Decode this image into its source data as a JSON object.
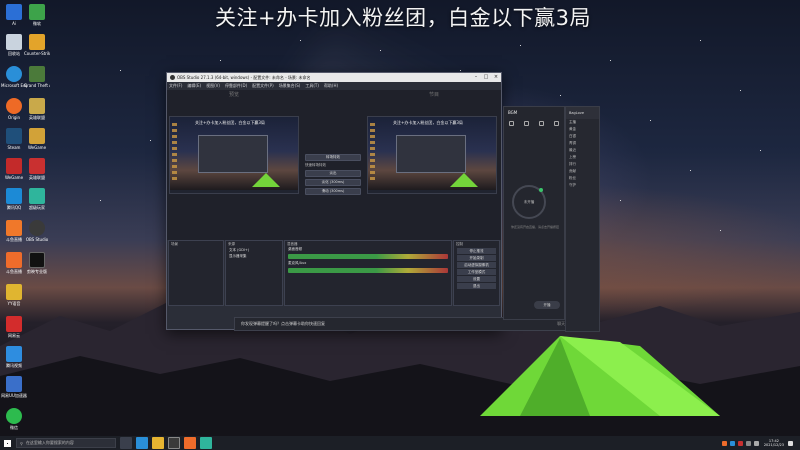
{
  "banner": {
    "text": "关注+办卡加入粉丝团，白金以下赢3局"
  },
  "desktop": {
    "icons": [
      {
        "label": "Ai",
        "icon": "app-icon-a",
        "color": "#2b6fd6"
      },
      {
        "label": "微软",
        "icon": "app-icon-green",
        "color": "#3da34a"
      },
      {
        "label": "回收站",
        "icon": "recycle-bin-icon",
        "color": "#c9d3de"
      },
      {
        "label": "Counter-Strike: Global Off...",
        "icon": "csgo-icon",
        "color": "#e3a42a"
      },
      {
        "label": "Microsoft Edge",
        "icon": "edge-icon",
        "color": "#2a8fd8"
      },
      {
        "label": "Grand Theft Auto V",
        "icon": "gta-icon",
        "color": "#4b7a3a"
      },
      {
        "label": "Origin",
        "icon": "origin-icon",
        "color": "#ee6a26"
      },
      {
        "label": "英雄联盟",
        "icon": "lol-icon",
        "color": "#c9a94a"
      },
      {
        "label": "Steam",
        "icon": "steam-icon",
        "color": "#1f4f7a"
      },
      {
        "label": "WeGame",
        "icon": "wegame-icon",
        "color": "#d2a238"
      },
      {
        "label": "WeGame",
        "icon": "wegame-icon-2",
        "color": "#c32a2a"
      },
      {
        "label": "英雄联盟",
        "icon": "lol-icon-2",
        "color": "#c93030"
      },
      {
        "label": "腾讯QQ",
        "icon": "qq-icon",
        "color": "#1c8ad6"
      },
      {
        "label": "超级玩家",
        "icon": "player-icon",
        "color": "#2fb59c"
      },
      {
        "label": "斗鱼直播",
        "icon": "douyu-icon",
        "color": "#f0782a"
      },
      {
        "label": "OBS Studio",
        "icon": "obs-icon",
        "color": "#3a3a3a"
      },
      {
        "label": "斗鱼直播",
        "icon": "douyu-icon-2",
        "color": "#ef6c2b"
      },
      {
        "label": "剪映专业版",
        "icon": "jianying-icon",
        "color": "#111111"
      },
      {
        "label": "YY语音",
        "icon": "yy-icon",
        "color": "#e0b530"
      },
      {
        "label": "网易云",
        "icon": "netease-icon",
        "color": "#d32c2c"
      },
      {
        "label": "腾讯视频",
        "icon": "video-icon",
        "color": "#2e8de0"
      },
      {
        "label": "网易UU加速器",
        "icon": "uu-icon",
        "color": "#3a6fc9"
      },
      {
        "label": "微信",
        "icon": "wechat-icon",
        "color": "#2dbb4e"
      }
    ]
  },
  "obs": {
    "title": "OBS Studio 27.1.3 (64-bit, windows) - 配置文件: 未命名 - 场景: 未命名",
    "menu": [
      "文件(F)",
      "编辑(E)",
      "视图(V)",
      "停靠部件(D)",
      "配置文件(P)",
      "场景集合(S)",
      "工具(T)",
      "帮助(H)"
    ],
    "preview_label": "预览",
    "program_label": "节目",
    "preview_caption": "关注+办卡加入粉丝团，白金以下赢3局",
    "transition_btn": "转场特效",
    "transition_label": "快速转场特效",
    "transition_items": [
      "淡出",
      "淡化 (300ms)",
      "滑动 (300ms)"
    ],
    "scenes_header": "场景",
    "sources_header": "来源",
    "scene_items": [
      "文本 (GDI+)",
      "显示器采集"
    ],
    "mixer_header": "混音器",
    "mixer_tracks": [
      "桌面音频",
      "麦克风/Aux"
    ],
    "controls_header": "控制",
    "controls": [
      "停止推流",
      "开始录制",
      "启动虚拟摄像机",
      "工作室模式",
      "设置",
      "退出"
    ],
    "status": "LIVE: 00:00:00  REC: 00:00:00  CPU: 1.0%, 30.00 fps"
  },
  "notice": {
    "text": "你发现弹幕提醒了吗？点击弹幕卡助你快速回复",
    "right_text": "聊天  弹幕  礼物  公告"
  },
  "side_app": {
    "title": "BGM",
    "ring_label": "未开播",
    "sub_text": "你还没有开启直播，请点击开播按钮",
    "bottom_btn": "开播"
  },
  "side_app2": {
    "title": "BagLove",
    "lines": [
      "主播",
      "黄金",
      "白银",
      "青铜",
      "最近",
      "上榜",
      "排行",
      "贡献",
      "粉丝",
      "守护"
    ]
  },
  "taskbar": {
    "search_placeholder": "在这里输入你要搜索的内容",
    "time": "17:42",
    "date": "2021/12/23"
  }
}
